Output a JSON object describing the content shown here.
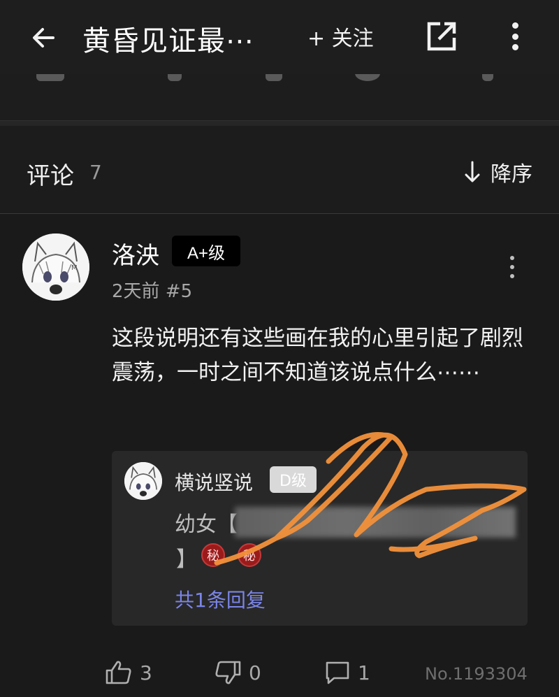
{
  "appbar": {
    "title": "黄昏见证最⋯",
    "follow_label": "+ 关注"
  },
  "comments_header": {
    "title": "评论",
    "count": "7",
    "sort_label": "降序"
  },
  "comment": {
    "username": "洛泱",
    "level": "A+级",
    "meta": "2天前 #5",
    "body": "这段说明还有这些画在我的心里引起了剧烈震荡，一时之间不知道该说点什么⋯⋯",
    "reply": {
      "username": "横说竖说",
      "level": "D级",
      "text_prefix": "幼女【",
      "text_suffix": "】",
      "secret_badges": [
        "秘",
        "秘"
      ],
      "more_replies": "共1条回复"
    },
    "actions": {
      "likes": "3",
      "dislikes": "0",
      "replies": "1",
      "post_number": "No.1193304"
    }
  },
  "colors": {
    "background": "#1a1a1a",
    "link": "#7b85e8",
    "scribble": "#f2913b",
    "badge_dark": "#000000",
    "badge_light": "#d9d9d9",
    "secret_badge": "#9b1b1b"
  },
  "icons": [
    "back-arrow-icon",
    "share-external-icon",
    "more-vertical-icon",
    "sort-down-arrow-icon",
    "thumb-up-icon",
    "thumb-down-icon",
    "comment-icon"
  ]
}
